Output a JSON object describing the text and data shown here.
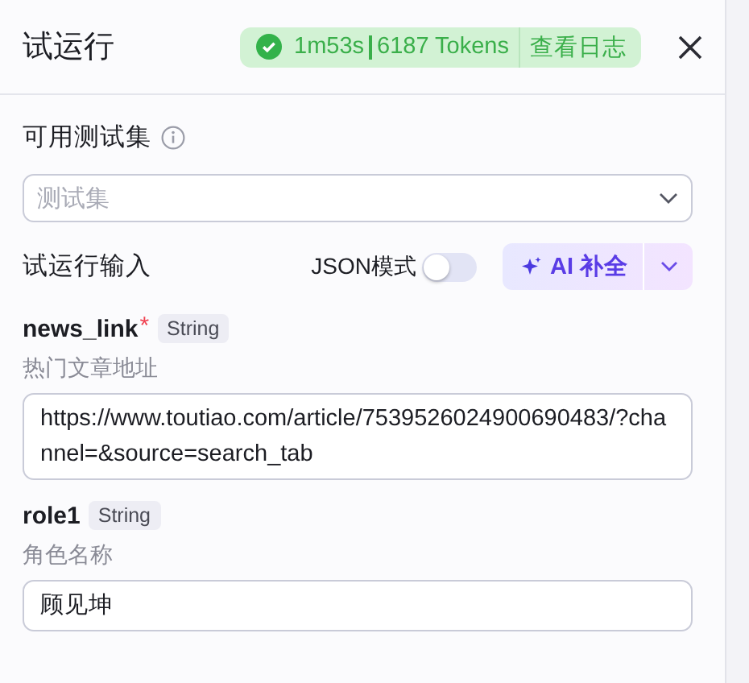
{
  "title": "试运行",
  "status": {
    "success": true,
    "duration": "1m53s",
    "tokens": "6187 Tokens",
    "log_link": "查看日志"
  },
  "testset": {
    "label": "可用测试集",
    "placeholder": "测试集"
  },
  "input_section": {
    "label": "试运行输入",
    "json_mode": {
      "label": "JSON模式",
      "on": false
    },
    "ai_button": "AI 补全"
  },
  "variables": [
    {
      "name": "news_link",
      "required_mark": "*",
      "type": "String",
      "description": "热门文章地址",
      "value": "https://www.toutiao.com/article/7539526024900690483/?channel=&source=search_tab"
    },
    {
      "name": "role1",
      "type": "String",
      "description": "角色名称",
      "value": "顾见坤"
    }
  ]
}
